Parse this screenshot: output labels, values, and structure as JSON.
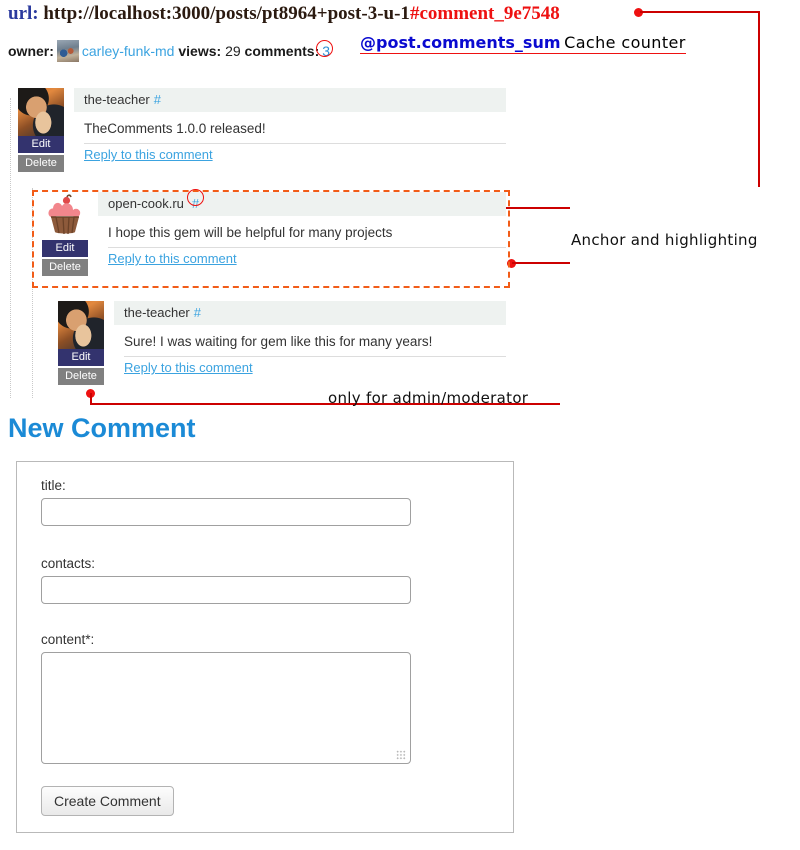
{
  "url_line": {
    "label": "url:",
    "base": "http://localhost:3000/posts/pt8964+post-3-u-1",
    "fragment": "#comment_9e7548"
  },
  "meta": {
    "owner_label": "owner:",
    "owner_name": "carley-funk-md",
    "views_label": "views:",
    "views_value": "29",
    "comments_label": "comments:",
    "comments_value": "3"
  },
  "annotations": {
    "cache_code": "@post.comments_sum",
    "cache_note": "Cache counter",
    "anchor_note": "Anchor and highlighting",
    "admin_note": "only for admin/moderator"
  },
  "comments": [
    {
      "author": "the-teacher",
      "anchor": "#",
      "text": "TheComments 1.0.0 released!",
      "reply_label": "Reply to this comment",
      "edit_label": "Edit",
      "delete_label": "Delete",
      "avatar": "avatar-teacher-photo"
    },
    {
      "author": "open-cook.ru",
      "anchor": "#",
      "text": "I hope this gem will be helpful for many projects",
      "reply_label": "Reply to this comment",
      "edit_label": "Edit",
      "delete_label": "Delete",
      "avatar": "avatar-cupcake-logo"
    },
    {
      "author": "the-teacher",
      "anchor": "#",
      "text": "Sure! I was waiting for gem like this  for many years!",
      "reply_label": "Reply to this comment",
      "edit_label": "Edit",
      "delete_label": "Delete",
      "avatar": "avatar-teacher-photo"
    }
  ],
  "form": {
    "heading": "New Comment",
    "title_label": "title:",
    "title_value": "",
    "contacts_label": "contacts:",
    "contacts_value": "",
    "content_label": "content*:",
    "content_value": "",
    "submit_label": "Create Comment"
  },
  "colors": {
    "link": "#3ba3e0",
    "heading": "#1b8ad6",
    "annotation": "#ee1111",
    "highlight_border": "#f25c18",
    "edit_button": "#33336e",
    "delete_button": "#808080",
    "comment_header_bg": "#eef2f0"
  }
}
